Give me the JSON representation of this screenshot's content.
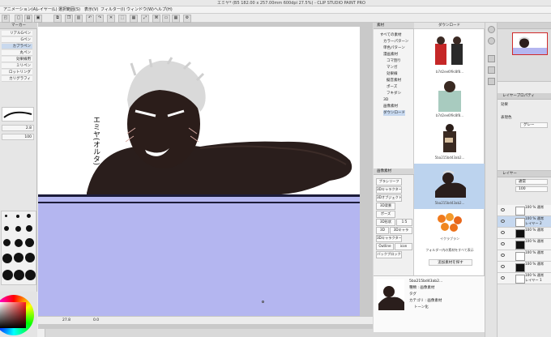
{
  "window": {
    "title": "エミヤ* (B5 182.00 x 257.00mm 600dpi 27.5%)  - CLIP STUDIO PAINT PRO"
  },
  "menu": [
    "アニメーション(A)",
    "レイヤー(L)",
    "選択範囲(S)",
    "表示(V)",
    "フィルター(I)",
    "ウィンドウ(W)",
    "ヘルプ(H)"
  ],
  "tool_property": {
    "header": "マーカー",
    "brushes": [
      "リアルGペン",
      "Gペン",
      "カブラペン",
      "丸ペン",
      "効果線用",
      "ミリペン",
      "ロットリング",
      "カリグラフィ"
    ],
    "size_value": "2.8",
    "opacity_value": "100"
  },
  "canvas": {
    "handwriting": "エミヤ(オルタ)"
  },
  "status": {
    "zoom": "27.8",
    "angle": "0.0"
  },
  "material_panel": {
    "header": "素材",
    "tree": [
      "すべての素材",
      "カラーパターン",
      "単色パターン",
      "漫画素材",
      "コマ割り",
      "マンガ",
      "効果線",
      "擬音素材",
      "ポーズ",
      "フキダシ",
      "3D",
      "画像素材",
      "ダウンロード"
    ],
    "list_header": "ダウンロード",
    "items": [
      {
        "caption": "b7d2ee6f9c8f8...",
        "selected": false
      },
      {
        "caption": "b7d2ee6f9c8f8...",
        "selected": false
      },
      {
        "caption": "5ba215bd43ab2...",
        "selected": false
      },
      {
        "caption": "b7d2ee6f9c8f8...",
        "selected": false
      },
      {
        "caption": "5ba215bd43ab2...",
        "selected": true
      },
      {
        "caption": "イクラブラン",
        "selected": false
      }
    ],
    "folder_line": "フォルダー内の素材をすべて表示",
    "download_button": "追加素材を探す",
    "tags": {
      "header": "画像素材",
      "buttons": [
        "ブラシリーフ",
        "3Dキャラクター",
        "3Dオブジェクト",
        "3D背景",
        "ポーズ",
        "3D形状",
        "1:5",
        "3D",
        "3Dキャラ",
        "3Dキャラクター",
        "Outline",
        "icon",
        "バックブロック"
      ]
    },
    "info": {
      "name": "5ba215bd43ab2...",
      "kind": "種類 : 画像素材",
      "tag": "タグ",
      "category": "カテゴリ : 画像素材",
      "tone": "トーン化"
    }
  },
  "layer_property": {
    "header": "レイヤープロパティ",
    "effect": "効果",
    "color": "表現色",
    "color_value": "グレー"
  },
  "layers": {
    "header": "レイヤー",
    "blend": "通常",
    "opacity": "100",
    "rows": [
      {
        "name": "100 % 通常",
        "sub": "",
        "selected": false
      },
      {
        "name": "100 % 通常",
        "sub": "レイヤー 2",
        "selected": true
      },
      {
        "name": "100 % 通常",
        "sub": "",
        "selected": false
      },
      {
        "name": "100 % 通常",
        "sub": "",
        "selected": false
      },
      {
        "name": "100 % 通常",
        "sub": "",
        "selected": false
      },
      {
        "name": "100 % 通常",
        "sub": "",
        "selected": false
      },
      {
        "name": "100 % 通常",
        "sub": "レイヤー 1",
        "selected": false
      }
    ]
  },
  "colors": {
    "accent": "#5b8fd6",
    "frame": "#b4b6f0",
    "frame_border": "#1c1c3a"
  }
}
